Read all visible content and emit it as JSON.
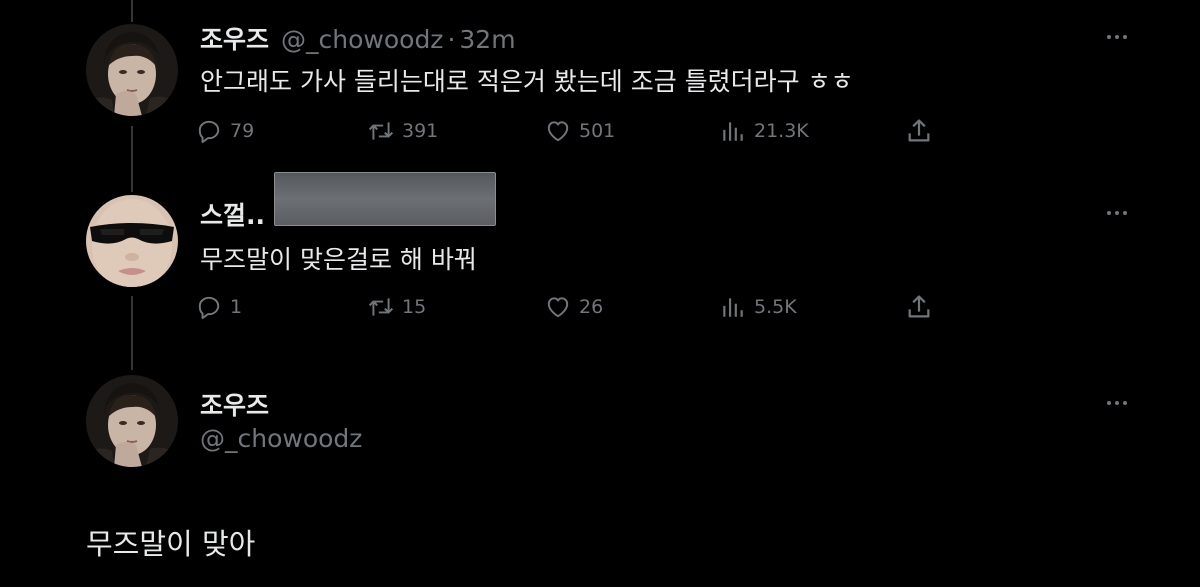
{
  "tweets": [
    {
      "display_name": "조우즈",
      "handle": "@_chowoodz",
      "separator": "·",
      "time": "32m",
      "text": "안그래도 가사 들리는대로 적은거 봤는데 조금 틀렸더라구 ㅎㅎ",
      "replies": "79",
      "retweets": "391",
      "likes": "501",
      "views": "21.3K"
    },
    {
      "display_name": "스껄..",
      "text": "무즈말이 맞은걸로 해 바꿔",
      "replies": "1",
      "retweets": "15",
      "likes": "26",
      "views": "5.5K"
    }
  ],
  "main_tweet": {
    "display_name": "조우즈",
    "handle": "@_chowoodz",
    "text": "무즈말이 맞아"
  },
  "icons": [
    "reply-icon",
    "retweet-icon",
    "like-icon",
    "views-icon",
    "share-icon",
    "more-icon"
  ],
  "colors": {
    "background": "#000000",
    "text_primary": "#e7e9ea",
    "text_secondary": "#71767b",
    "thread_line": "#333639"
  }
}
